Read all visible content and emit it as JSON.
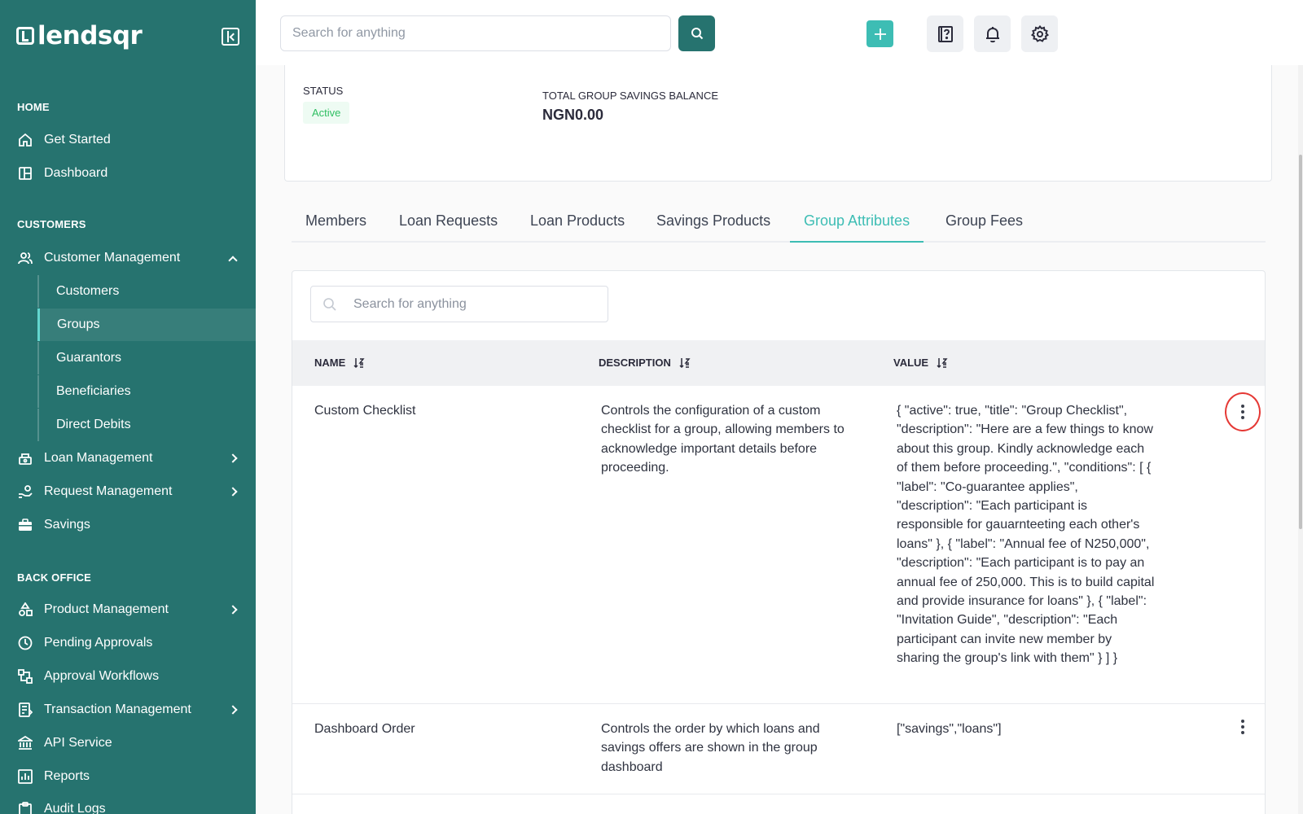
{
  "app": {
    "logo_text": "lendsqr"
  },
  "sidebar": {
    "sections": {
      "home": "HOME",
      "customers": "CUSTOMERS",
      "back_office": "BACK OFFICE"
    },
    "items": {
      "get_started": "Get Started",
      "dashboard": "Dashboard",
      "customer_management": "Customer Management",
      "customers": "Customers",
      "groups": "Groups",
      "guarantors": "Guarantors",
      "beneficiaries": "Beneficiaries",
      "direct_debits": "Direct Debits",
      "loan_management": "Loan Management",
      "request_management": "Request Management",
      "savings": "Savings",
      "product_management": "Product Management",
      "pending_approvals": "Pending Approvals",
      "approval_workflows": "Approval Workflows",
      "transaction_management": "Transaction Management",
      "api_service": "API Service",
      "reports": "Reports",
      "audit_logs": "Audit Logs"
    }
  },
  "topbar": {
    "search_placeholder": "Search for anything"
  },
  "group_info": {
    "status_label": "STATUS",
    "status_value": "Active",
    "balance_label": "TOTAL GROUP SAVINGS BALANCE",
    "balance_value": "NGN0.00"
  },
  "tabs": {
    "members": "Members",
    "loan_requests": "Loan Requests",
    "loan_products": "Loan Products",
    "savings_products": "Savings Products",
    "group_attributes": "Group Attributes",
    "group_fees": "Group Fees"
  },
  "table": {
    "search_placeholder": "Search for anything",
    "headers": {
      "name": "NAME",
      "description": "DESCRIPTION",
      "value": "VALUE"
    },
    "rows": [
      {
        "name": "Custom Checklist",
        "description": "Controls the configuration of a custom checklist for a group, allowing members to acknowledge important details before proceeding.",
        "value": "{ \"active\": true, \"title\": \"Group Checklist\", \"description\": \"Here are a few things to know about this group. Kindly acknowledge each of them before proceeding.\", \"conditions\": [ { \"label\": \"Co-guarantee applies\", \"description\": \"Each participant is responsible for gauarnteeting each other's loans\" }, { \"label\": \"Annual fee of N250,000\", \"description\": \"Each participant is to pay an annual fee of 250,000. This is to build capital and provide insurance for loans\" }, { \"label\": \"Invitation Guide\", \"description\": \"Each participant can invite new member by sharing the group's link with them\" } ] }"
      },
      {
        "name": "Dashboard Order",
        "description": "Controls the order by which loans and savings offers are shown in the group dashboard",
        "value": "[\"savings\",\"loans\"]"
      }
    ]
  },
  "colors": {
    "sidebar_bg": "#26736f",
    "accent": "#3dbdb4",
    "status_green": "#2fbf62",
    "highlight_circle": "#e53935"
  }
}
